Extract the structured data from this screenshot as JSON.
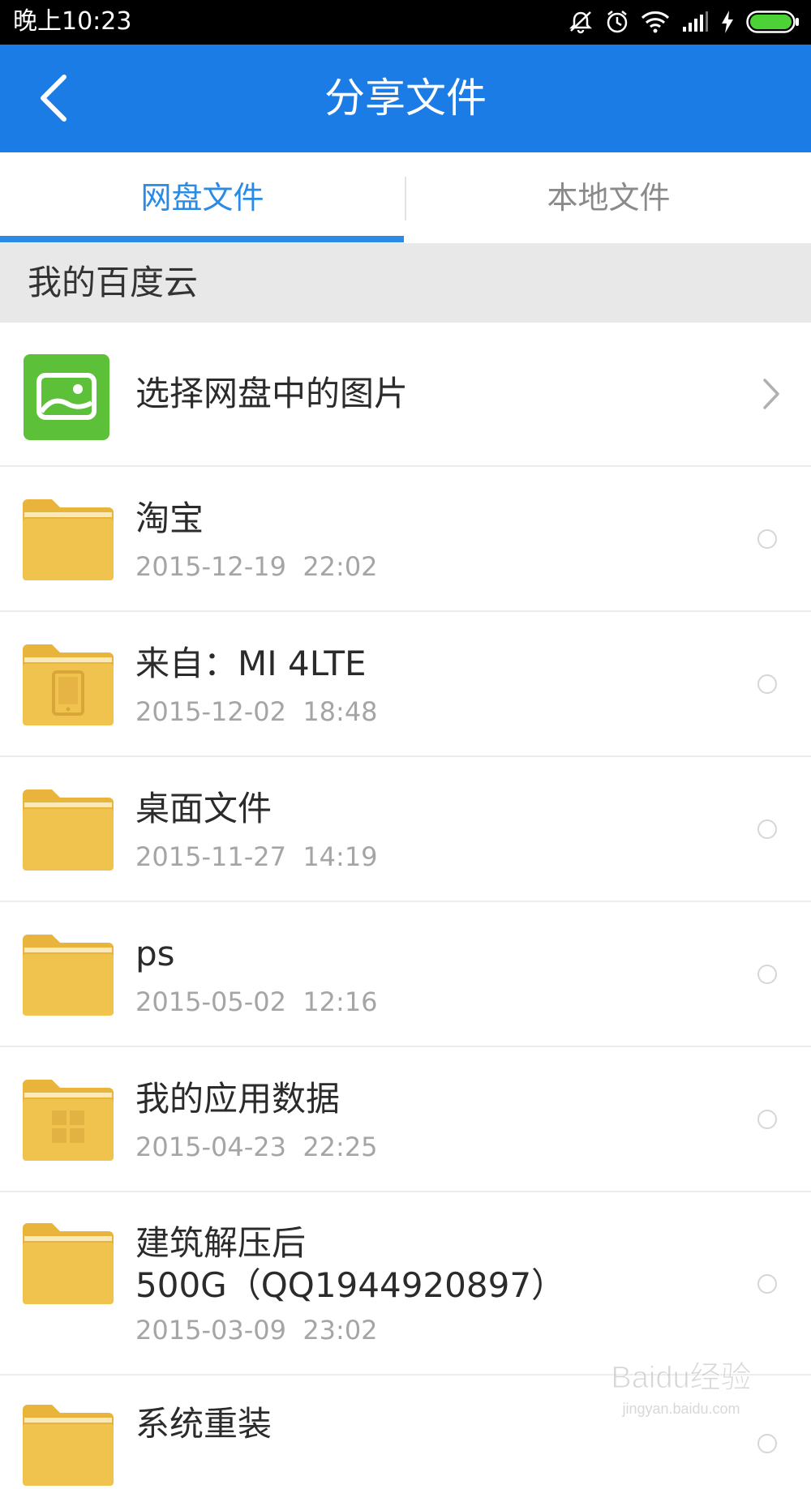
{
  "status_bar": {
    "time": "晚上10:23",
    "icons": [
      "mute-icon",
      "alarm-icon",
      "wifi-icon",
      "signal-icon",
      "charging-icon",
      "battery-icon"
    ],
    "battery_color": "#4cd137"
  },
  "app_bar": {
    "title": "分享文件",
    "back_icon": "chevron-left-icon",
    "background": "#1c7ce6"
  },
  "tabs": [
    {
      "label": "网盘文件",
      "selected": true
    },
    {
      "label": "本地文件",
      "selected": false
    }
  ],
  "accent_color": "#2a8be6",
  "section": {
    "title": "我的百度云"
  },
  "picker_row": {
    "label": "选择网盘中的图片",
    "icon": "image-icon",
    "icon_color": "#5cc039"
  },
  "files": [
    {
      "name": "淘宝",
      "date": "2015-12-19  22:02",
      "icon": "folder-icon"
    },
    {
      "name": "来自：MI 4LTE",
      "date": "2015-12-02  18:48",
      "icon": "device-folder-icon"
    },
    {
      "name": "桌面文件",
      "date": "2015-11-27  14:19",
      "icon": "folder-icon"
    },
    {
      "name": "ps",
      "date": "2015-05-02  12:16",
      "icon": "folder-icon"
    },
    {
      "name": "我的应用数据",
      "date": "2015-04-23  22:25",
      "icon": "apps-folder-icon"
    },
    {
      "name_line1": "建筑解压后",
      "name_line2": "500G（QQ1944920897）",
      "date": "2015-03-09  23:02",
      "icon": "folder-icon"
    },
    {
      "name": "系统重装",
      "icon": "folder-icon"
    }
  ],
  "watermark": {
    "brand": "Baidu经验",
    "url": "jingyan.baidu.com"
  }
}
